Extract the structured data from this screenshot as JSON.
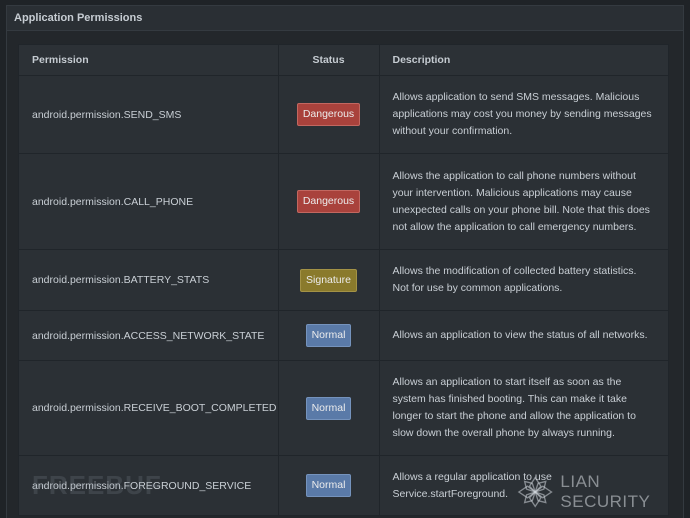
{
  "panel": {
    "title": "Application Permissions"
  },
  "table": {
    "headers": {
      "permission": "Permission",
      "status": "Status",
      "description": "Description"
    },
    "rows": [
      {
        "permission": "android.permission.SEND_SMS",
        "status": "Dangerous",
        "description": "Allows application to send SMS messages. Malicious applications may cost you money by sending messages without your confirmation."
      },
      {
        "permission": "android.permission.CALL_PHONE",
        "status": "Dangerous",
        "description": "Allows the application to call phone numbers without your intervention. Malicious applications may cause unexpected calls on your phone bill. Note that this does not allow the application to call emergency numbers."
      },
      {
        "permission": "android.permission.BATTERY_STATS",
        "status": "Signature",
        "description": "Allows the modification of collected battery statistics. Not for use by common applications."
      },
      {
        "permission": "android.permission.ACCESS_NETWORK_STATE",
        "status": "Normal",
        "description": "Allows an application to view the status of all networks."
      },
      {
        "permission": "android.permission.RECEIVE_BOOT_COMPLETED",
        "status": "Normal",
        "description": "Allows an application to start itself as soon as the system has finished booting. This can make it take longer to start the phone and allow the application to slow down the overall phone by always running."
      },
      {
        "permission": "android.permission.FOREGROUND_SERVICE",
        "status": "Normal",
        "description": "Allows a regular application to use Service.startForeground."
      }
    ]
  },
  "status_colors": {
    "Dangerous": "#a9423c",
    "Signature": "#8a7a2c",
    "Normal": "#5a7aa8"
  },
  "watermarks": {
    "left": "FREEBUF",
    "right": "LIAN SECURITY"
  }
}
